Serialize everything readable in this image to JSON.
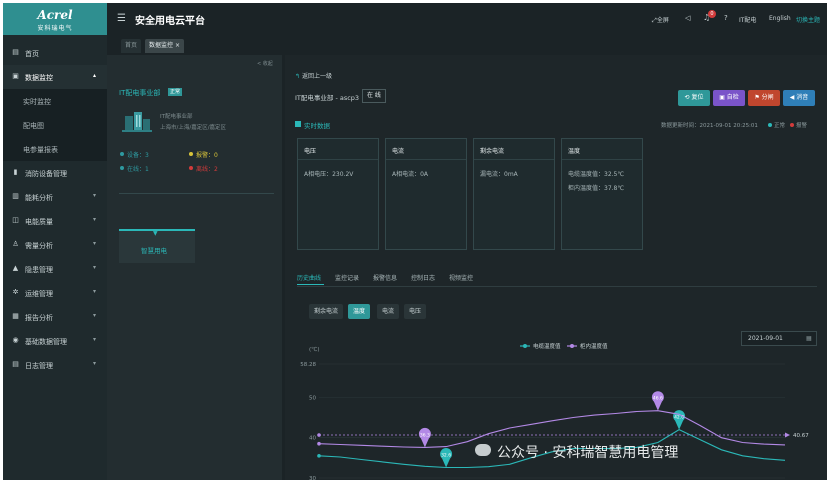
{
  "app": {
    "logo_brand": "Acrel",
    "logo_sub": "安科瑞电气",
    "title": "安全用电云平台"
  },
  "topbar": {
    "fullscreen": "全屏",
    "notification_count": "0",
    "user": "IT配电",
    "language": "English",
    "theme": "切换主题"
  },
  "tabs": [
    {
      "label": "首页"
    },
    {
      "label": "数据监控"
    }
  ],
  "sidebar": {
    "items": [
      {
        "label": "首页",
        "icon": "home-icon"
      },
      {
        "label": "数据监控",
        "icon": "monitor-icon"
      },
      {
        "label": "消防设备管理",
        "icon": "fire-icon"
      },
      {
        "label": "能耗分析",
        "icon": "bar-chart-icon"
      },
      {
        "label": "电能质量",
        "icon": "power-icon"
      },
      {
        "label": "需量分析",
        "icon": "demand-icon"
      },
      {
        "label": "隐患管理",
        "icon": "warning-icon"
      },
      {
        "label": "运维管理",
        "icon": "gear-icon"
      },
      {
        "label": "报告分析",
        "icon": "report-icon"
      },
      {
        "label": "基础数据管理",
        "icon": "database-icon"
      },
      {
        "label": "日志管理",
        "icon": "log-icon"
      }
    ],
    "sub_items": [
      {
        "label": "实时监控"
      },
      {
        "label": "配电图"
      },
      {
        "label": "电参量报表"
      }
    ]
  },
  "left_panel": {
    "collapse_label": "< 收起",
    "org_name": "IT配电事业部",
    "org_badge": "正常",
    "org_line1": "IT配电事业部",
    "org_line2": "上海市/上海/嘉定区/嘉定区",
    "stats": [
      {
        "label": "设备",
        "value": "3",
        "color": "#2e9aa0"
      },
      {
        "label": "报警",
        "value": "0",
        "color": "#d8c43a"
      },
      {
        "label": "在线",
        "value": "1",
        "color": "#2e9aa0"
      },
      {
        "label": "离线",
        "value": "2",
        "color": "#d23b3b"
      }
    ],
    "device_label": "智慧用电"
  },
  "main": {
    "back_label": "返回上一级",
    "device_name": "IT配电事业部 - ascp3",
    "device_status": "在 线",
    "buttons": [
      {
        "label": "复位",
        "color": "#2f9899",
        "icon": "reset-icon"
      },
      {
        "label": "自检",
        "color": "#7a54c9",
        "icon": "self-check-icon"
      },
      {
        "label": "分闸",
        "color": "#c0462e",
        "icon": "flag-icon"
      },
      {
        "label": "消音",
        "color": "#2f7fb8",
        "icon": "mute-icon"
      }
    ],
    "realtime_title": "实时数据",
    "update_time": "数据更新时间：2021-09-01 20:25:01",
    "legend_normal": "正常",
    "legend_alarm": "报警",
    "cards": [
      {
        "title": "电压",
        "lines": [
          "A相电压：230.2V"
        ]
      },
      {
        "title": "电流",
        "lines": [
          "A相电流：0A"
        ]
      },
      {
        "title": "剩余电流",
        "lines": [
          "漏电流：0mA"
        ]
      },
      {
        "title": "温度",
        "lines": [
          "电缆温度值：32.5℃",
          "柜内温度值：37.8℃"
        ]
      }
    ],
    "data_tabs": [
      "历史曲线",
      "监控记录",
      "报警信息",
      "控制日志",
      "视频监控"
    ],
    "pills": [
      "剩余电流",
      "温度",
      "电流",
      "电压"
    ],
    "date_picker": "2021-09-01",
    "watermark": "公众号 · 安科瑞智慧用电管理"
  },
  "chart_data": {
    "type": "line",
    "ylabel": "(℃)",
    "ylim": [
      30,
      58.28
    ],
    "yticks": [
      30,
      40,
      50,
      58.28
    ],
    "legend": "top-center",
    "series": [
      {
        "name": "电缆温度值",
        "color": "#2bb8b8",
        "values": [
          35.5,
          35.2,
          34.6,
          34.0,
          33.4,
          32.9,
          32.6,
          32.6,
          32.8,
          33.4,
          35.0,
          36.5,
          37.3,
          37.3,
          37.3,
          37.6,
          38.8,
          42.0,
          39.5,
          37.0,
          35.5,
          34.8,
          34.4
        ],
        "max_marker": {
          "index": 17,
          "label": "42.0"
        },
        "min_marker": {
          "index": 6,
          "label": "32.6"
        }
      },
      {
        "name": "柜内温度值",
        "color": "#b389e6",
        "values": [
          38.5,
          38.3,
          38.1,
          37.9,
          37.7,
          37.6,
          37.8,
          39.0,
          41.0,
          42.4,
          43.3,
          44.2,
          45.0,
          45.6,
          46.0,
          46.5,
          46.7,
          45.8,
          43.0,
          40.0,
          38.8,
          38.4,
          38.2
        ],
        "max_marker": {
          "index": 16,
          "label": "46.6"
        },
        "min_marker": {
          "index": 5,
          "label": "36.3"
        }
      }
    ],
    "reference_line": {
      "value": 40.67,
      "label": "40.67"
    }
  }
}
